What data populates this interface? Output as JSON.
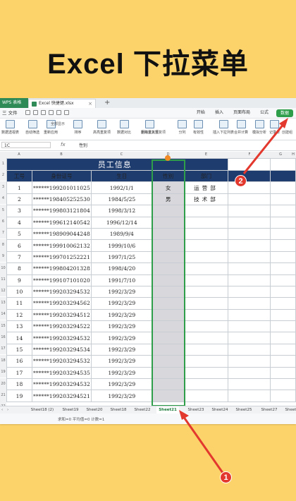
{
  "headline": "Excel 下拉菜单",
  "window": {
    "app_tab": "WPS 表格",
    "file_tab": "Excel 快捷键.xlsx",
    "new_tab": "+"
  },
  "menu": {
    "file": "三 文件",
    "tabs": [
      "开始",
      "插入",
      "页面布局",
      "公式",
      "数据"
    ],
    "active_tab": "数据"
  },
  "ribbon": {
    "buttons": [
      "数据透视表",
      "自动筛选",
      "重新应用",
      "排序",
      "高亮重复项",
      "数据对比",
      "删除重复项",
      "分列",
      "有效性",
      "插入下拉列表",
      "合并计算",
      "模拟分析",
      "记录单"
    ],
    "small": [
      "全部显示",
      "拒绝录入重复项",
      "创建组"
    ]
  },
  "formula": {
    "name_box": "1C",
    "fx": "fx",
    "value": "性别"
  },
  "columns": [
    "A",
    "B",
    "C",
    "D",
    "E",
    "F",
    "G",
    "H"
  ],
  "table": {
    "title": "员工信息",
    "headers": [
      "工号",
      "身份证号",
      "生日",
      "性别",
      "部门"
    ],
    "rows": [
      {
        "id": "1",
        "idcard": "******199201011025",
        "birthday": "1992/1/1",
        "gender": "女",
        "dept": "运营部"
      },
      {
        "id": "2",
        "idcard": "******198405252530",
        "birthday": "1984/5/25",
        "gender": "男",
        "dept": "技术部"
      },
      {
        "id": "3",
        "idcard": "******199803121804",
        "birthday": "1998/3/12",
        "gender": "",
        "dept": ""
      },
      {
        "id": "4",
        "idcard": "******199612140542",
        "birthday": "1996/12/14",
        "gender": "",
        "dept": ""
      },
      {
        "id": "5",
        "idcard": "******198909044248",
        "birthday": "1989/9/4",
        "gender": "",
        "dept": ""
      },
      {
        "id": "6",
        "idcard": "******199910062132",
        "birthday": "1999/10/6",
        "gender": "",
        "dept": ""
      },
      {
        "id": "7",
        "idcard": "******199701252221",
        "birthday": "1997/1/25",
        "gender": "",
        "dept": ""
      },
      {
        "id": "8",
        "idcard": "******199804201328",
        "birthday": "1998/4/20",
        "gender": "",
        "dept": ""
      },
      {
        "id": "9",
        "idcard": "******199107101020",
        "birthday": "1991/7/10",
        "gender": "",
        "dept": ""
      },
      {
        "id": "10",
        "idcard": "******199203294532",
        "birthday": "1992/3/29",
        "gender": "",
        "dept": ""
      },
      {
        "id": "11",
        "idcard": "******199203294562",
        "birthday": "1992/3/29",
        "gender": "",
        "dept": ""
      },
      {
        "id": "12",
        "idcard": "******199203294512",
        "birthday": "1992/3/29",
        "gender": "",
        "dept": ""
      },
      {
        "id": "13",
        "idcard": "******199203294522",
        "birthday": "1992/3/29",
        "gender": "",
        "dept": ""
      },
      {
        "id": "14",
        "idcard": "******199203294532",
        "birthday": "1992/3/29",
        "gender": "",
        "dept": ""
      },
      {
        "id": "15",
        "idcard": "******199203294534",
        "birthday": "1992/3/29",
        "gender": "",
        "dept": ""
      },
      {
        "id": "16",
        "idcard": "******199203294532",
        "birthday": "1992/3/29",
        "gender": "",
        "dept": ""
      },
      {
        "id": "17",
        "idcard": "******199203294535",
        "birthday": "1992/3/29",
        "gender": "",
        "dept": ""
      },
      {
        "id": "18",
        "idcard": "******199203294532",
        "birthday": "1992/3/29",
        "gender": "",
        "dept": ""
      },
      {
        "id": "19",
        "idcard": "******199203294521",
        "birthday": "1992/3/29",
        "gender": "",
        "dept": ""
      }
    ]
  },
  "sheets": [
    "Sheet18 (2)",
    "Sheet19",
    "Sheet20",
    "Sheet18",
    "Sheet22",
    "Sheet21",
    "Sheet23",
    "Sheet24",
    "Sheet25",
    "Sheet27",
    "Sheet28"
  ],
  "active_sheet": "Sheet21",
  "status": {
    "stats": "求和=0  平均值=0  计数=1"
  },
  "badges": [
    "1",
    "2"
  ],
  "colors": {
    "background": "#fcd26a",
    "header_fill": "#1f3c6e",
    "accent_green": "#2e9e4b",
    "annotation_red": "#e2382d"
  }
}
